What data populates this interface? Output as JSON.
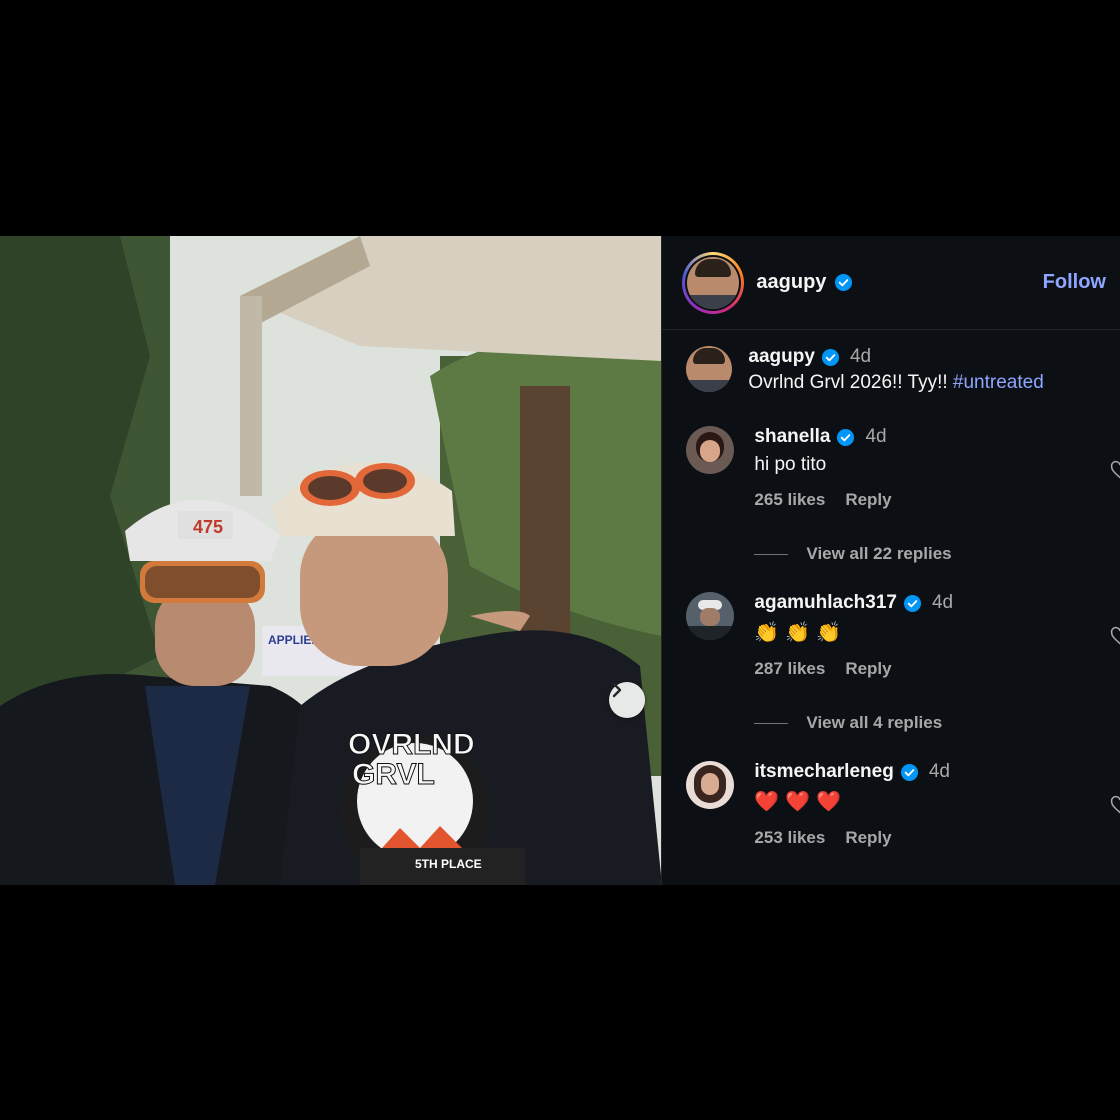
{
  "post": {
    "author": "aagupy",
    "follow_label": "Follow"
  },
  "caption": {
    "user": "aagupy",
    "time": "4d",
    "text": "Ovrlnd Grvl 2026!! Tyy!!",
    "hashtag": "#untreated"
  },
  "comments": [
    {
      "user": "shanella",
      "time": "4d",
      "text": "hi po tito",
      "likes": "265 likes",
      "reply_label": "Reply",
      "view_replies": "View all 22 replies"
    },
    {
      "user": "agamuhlach317",
      "time": "4d",
      "text": "👏👏👏",
      "likes": "287 likes",
      "reply_label": "Reply",
      "view_replies": "View all 4 replies"
    },
    {
      "user": "itsmecharleneg",
      "time": "4d",
      "text": "❤️❤️❤️",
      "likes": "253 likes",
      "reply_label": "Reply"
    }
  ],
  "photo": {
    "banner_text": "APPLIED NUTRITION",
    "trophy_title_1": "OVRLND",
    "trophy_title_2": "GRVL",
    "trophy_place": "5TH PLACE",
    "helmet_number": "475"
  },
  "colors": {
    "panel_bg": "#0c1014",
    "accent_blue": "#8fa6ff",
    "verified_blue": "#0095f6",
    "muted_text": "#a8a8a8"
  },
  "icons": {
    "next": "chevron-right-icon",
    "verified": "verified-badge-icon",
    "like": "heart-outline-icon"
  }
}
